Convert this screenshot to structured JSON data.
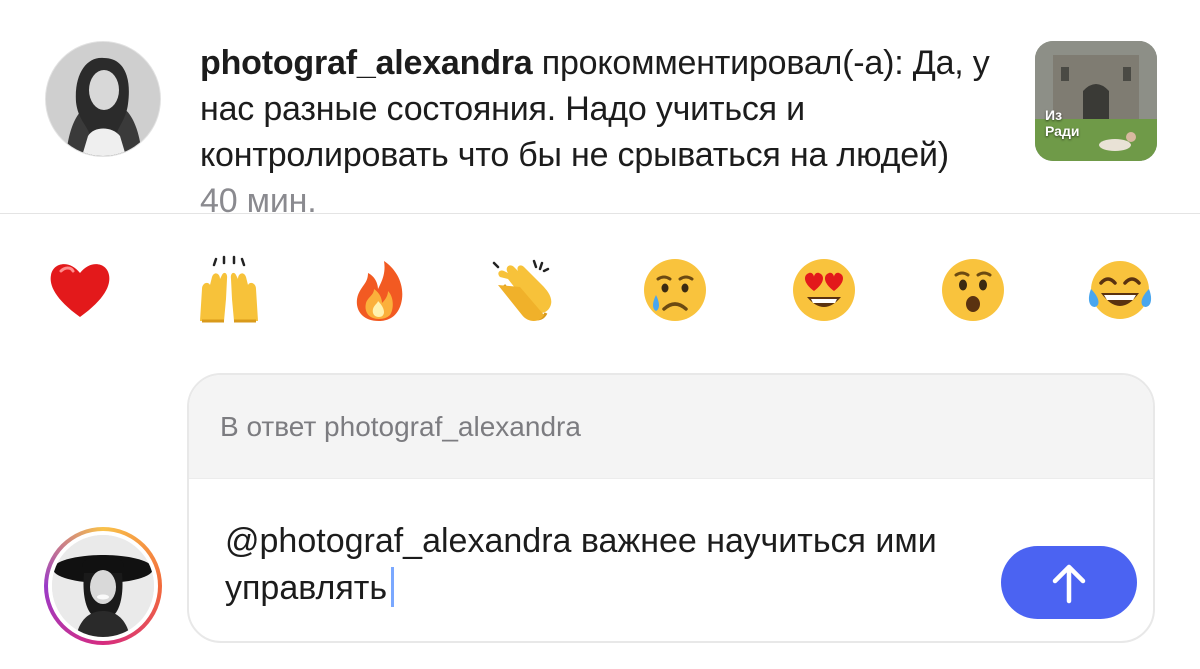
{
  "notification": {
    "username": "photograf_alexandra",
    "action": " прокомментировал(-а): ",
    "comment": "Да, у нас разные состояния. Надо учиться и контролировать  что бы не срываться на людей)",
    "time": "40 мин.",
    "avatar_icon": "user-avatar-photo",
    "post_thumb_icon": "post-thumbnail-photo",
    "post_thumb_caption": "Из\nРади"
  },
  "reactions": [
    {
      "name": "red-heart",
      "icon": "heart-emoji"
    },
    {
      "name": "raising-hands",
      "icon": "raising-hands-emoji"
    },
    {
      "name": "fire",
      "icon": "fire-emoji"
    },
    {
      "name": "clapping-hands",
      "icon": "clapping-hands-emoji"
    },
    {
      "name": "crying-face",
      "icon": "crying-face-emoji"
    },
    {
      "name": "heart-eyes",
      "icon": "heart-eyes-emoji"
    },
    {
      "name": "surprised-face",
      "icon": "surprised-face-emoji"
    },
    {
      "name": "tears-of-joy",
      "icon": "tears-of-joy-emoji"
    }
  ],
  "reply": {
    "header_label": "В ответ photograf_alexandra",
    "input_value": "@photograf_alexandra важнее научиться ими управлять",
    "send_icon": "arrow-up-icon"
  },
  "colors": {
    "send_button": "#4b63f2",
    "time_text": "#8a8a8f",
    "reply_header_bg": "#f4f4f4",
    "caret": "#7aa8ff"
  }
}
